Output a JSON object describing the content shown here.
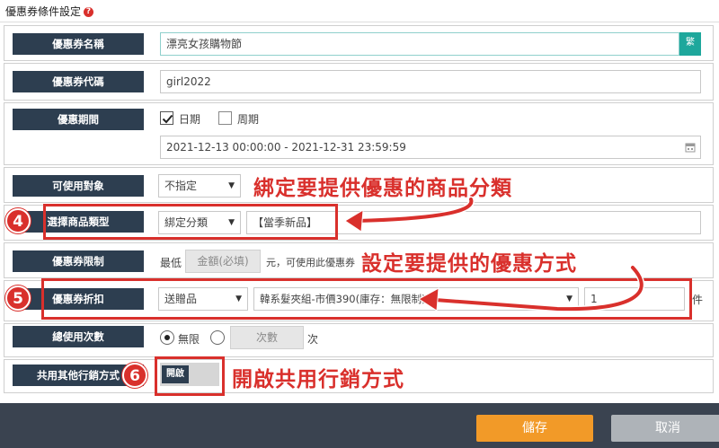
{
  "header": {
    "title": "優惠券條件設定",
    "help_icon": "?"
  },
  "fields": {
    "name": {
      "label": "優惠券名稱",
      "value": "漂亮女孩購物節",
      "side_button": "繁"
    },
    "code": {
      "label": "優惠券代碼",
      "value": "girl2022"
    },
    "period": {
      "label": "優惠期間",
      "option_date": "日期",
      "option_cycle": "周期",
      "date_range": "2021-12-13 00:00:00 - 2021-12-31 23:59:59"
    },
    "target": {
      "label": "可使用對象",
      "selected": "不指定"
    },
    "product_type": {
      "label": "選擇商品類型",
      "selected": "綁定分類",
      "tag_value": "【當季新品】"
    },
    "limit": {
      "label": "優惠券限制",
      "prefix": "最低",
      "placeholder": "金額(必填)",
      "suffix": "元，可使用此優惠券"
    },
    "discount": {
      "label": "優惠券折扣",
      "type_selected": "送贈品",
      "gift_selected": "韓系髮夾組-市價390(庫存：無限制)",
      "quantity": "1",
      "unit": "件"
    },
    "usage": {
      "label": "總使用次數",
      "option_unlimited": "無限",
      "placeholder": "次數",
      "unit": "次"
    },
    "combine": {
      "label": "共用其他行銷方式",
      "toggle_label": "開啟"
    }
  },
  "annotations": {
    "badge_4": "4",
    "badge_5": "5",
    "badge_6": "6",
    "note_category": "綁定要提供優惠的商品分類",
    "note_discount": "設定要提供的優惠方式",
    "note_combine": "開啟共用行銷方式"
  },
  "footer": {
    "save_label": "儲存",
    "cancel_label": "取消"
  },
  "colors": {
    "label_bg": "#2d3e50",
    "accent_red": "#d9302c",
    "save_orange": "#f29a28",
    "cancel_gray": "#aeb3b8",
    "teal": "#1ea79c"
  }
}
